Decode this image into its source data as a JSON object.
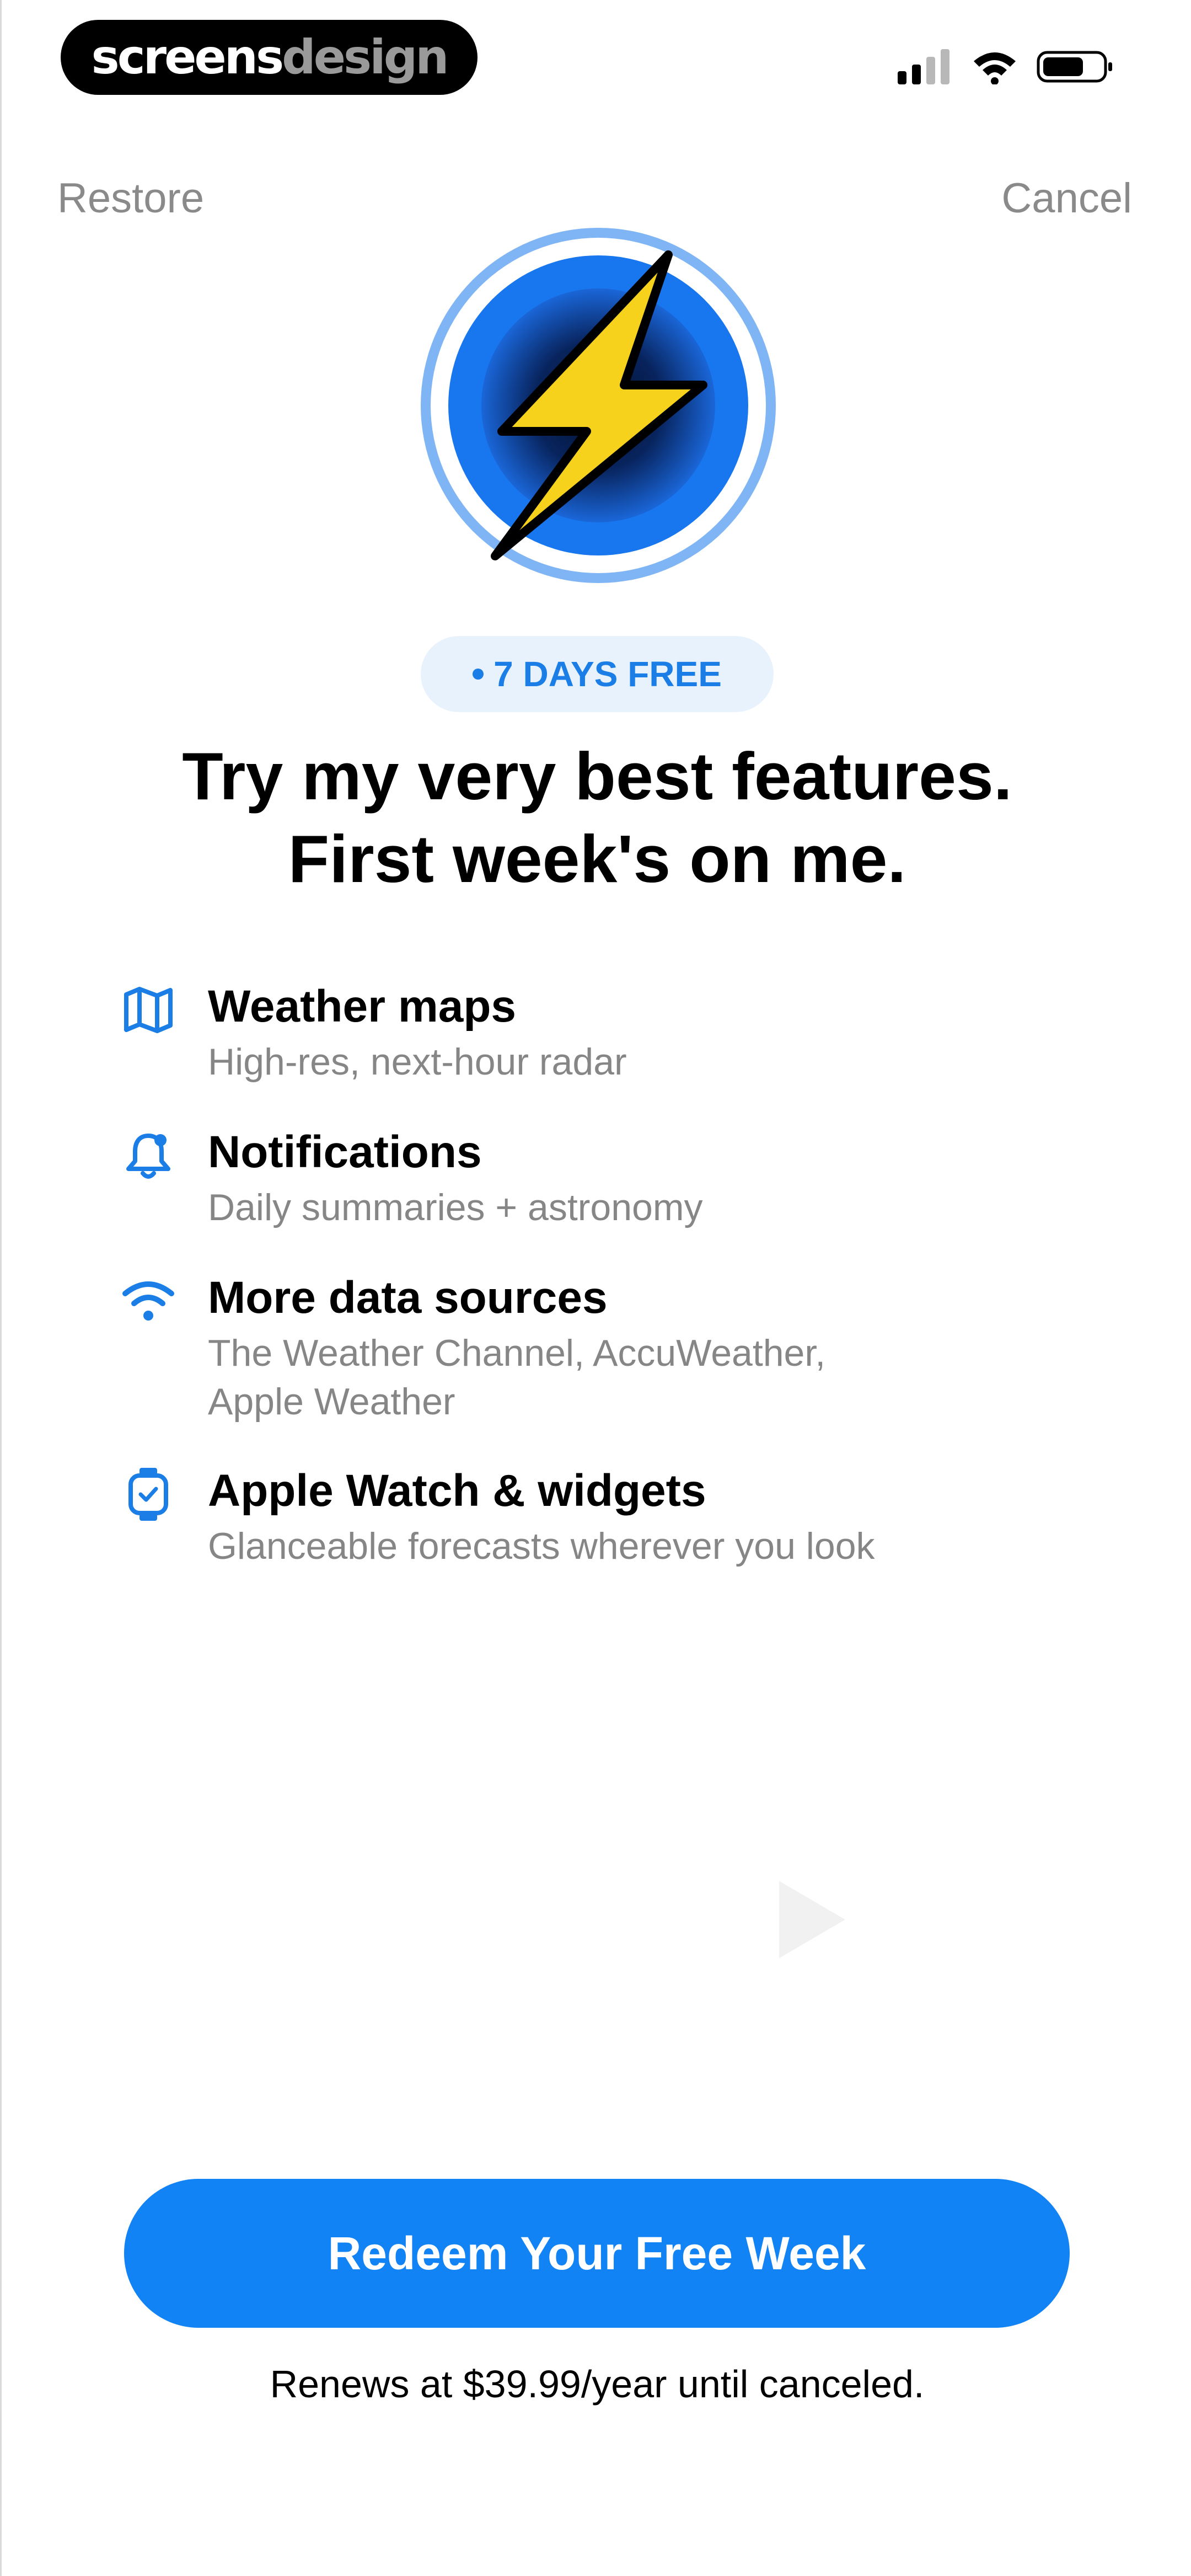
{
  "status_bar": {
    "brand_part1": "screens",
    "brand_part2": "design",
    "signal_icon": "cellular-signal-icon",
    "wifi_icon": "wifi-icon",
    "battery_icon": "battery-icon"
  },
  "header": {
    "restore_label": "Restore",
    "cancel_label": "Cancel"
  },
  "hero": {
    "icon": "lightning-bolt-icon"
  },
  "badge": {
    "text": "7 DAYS FREE"
  },
  "headline": {
    "line1": "Try my very best features.",
    "line2": "First week's on me."
  },
  "features": [
    {
      "icon": "map-icon",
      "title": "Weather maps",
      "subtitle": "High-res, next-hour radar"
    },
    {
      "icon": "bell-icon",
      "title": "Notifications",
      "subtitle": "Daily summaries + astronomy"
    },
    {
      "icon": "wifi-icon",
      "title": "More data sources",
      "subtitle_line1": "The Weather Channel, AccuWeather,",
      "subtitle_line2": "Apple Weather"
    },
    {
      "icon": "watch-icon",
      "title": "Apple Watch & widgets",
      "subtitle": "Glanceable forecasts wherever you look"
    }
  ],
  "cta": {
    "label": "Redeem Your Free Week"
  },
  "footer": {
    "renew_text": "Renews at $39.99/year until canceled."
  },
  "colors": {
    "accent": "#1283f4",
    "badge_bg": "#e8f2fd",
    "bolt": "#f7d21c",
    "secondary_text": "#868686"
  }
}
